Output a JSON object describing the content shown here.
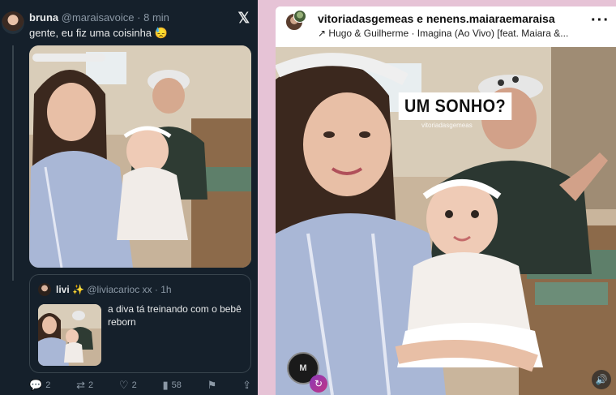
{
  "tweet": {
    "author_name": "bruna",
    "author_handle": "@maraisavoice",
    "time_sep": "·",
    "time": "8 min",
    "text": "gente, eu fiz uma coisinha 😓",
    "platform_icon": "x-logo-icon",
    "quote": {
      "author_name": "livi",
      "sparkle": "✨",
      "author_handle": "@liviacarioc xx",
      "time_sep": "·",
      "time": "1h",
      "text": "a diva tá treinando com o bebê reborn"
    },
    "actions": {
      "replies": "2",
      "retweets": "2",
      "likes": "2",
      "views": "58"
    }
  },
  "story": {
    "username": "vitoriadasgemeas e nenens.maiaraemaraisa",
    "music_icon": "arrow-up-right-icon",
    "music": "Hugo & Guilherme · Imagina (Ao Vivo) [feat. Maiara &...",
    "menu_icon": "more-dots-icon",
    "sticker": "UM SONHO?",
    "watermark": "vitoriadasgemeas",
    "logo_text": "M",
    "sound_icon": "speaker-icon",
    "remix_icon": "remix-icon"
  },
  "colors": {
    "twitter_bg": "#15202b",
    "twitter_border": "#38444d",
    "twitter_muted": "#8b98a5",
    "page_bg": "#e6c3d6"
  }
}
